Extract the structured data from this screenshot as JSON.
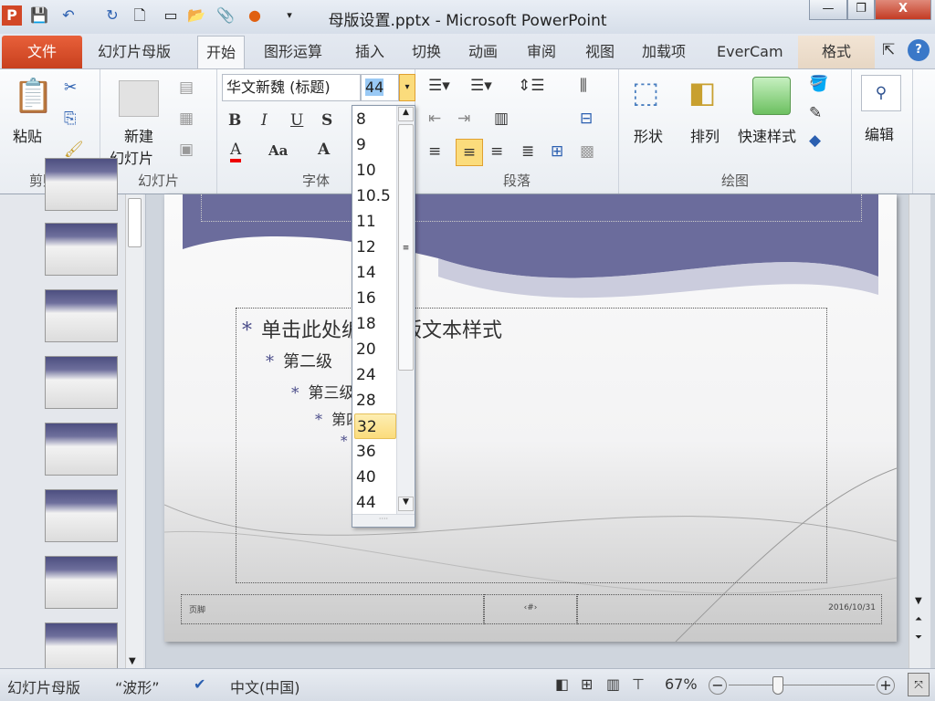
{
  "window": {
    "title": "母版设置.pptx - Microsoft PowerPoint",
    "minimize": "—",
    "restore": "❐",
    "close": "X"
  },
  "tabs": [
    "文件",
    "幻灯片母版",
    "开始",
    "图形运算",
    "插入",
    "切换",
    "动画",
    "审阅",
    "视图",
    "加载项",
    "EverCam",
    "格式"
  ],
  "ribbon": {
    "clipboard": {
      "label": "剪贴板",
      "paste": "粘贴"
    },
    "slides": {
      "label": "幻灯片",
      "new_slide_1": "新建",
      "new_slide_2": "幻灯片"
    },
    "font": {
      "label": "字体",
      "font_name": "华文新魏 (标题)",
      "font_size": "44",
      "bold": "B",
      "italic": "I",
      "underline": "U",
      "shadow": "S",
      "font_color": "A",
      "change_case": "Aa",
      "grow": "A"
    },
    "paragraph": {
      "label": "段落"
    },
    "drawing": {
      "label": "绘图",
      "shapes": "形状",
      "arrange": "排列",
      "quick_styles": "快速样式"
    },
    "editing": {
      "label": "编辑",
      "edit": "编辑"
    }
  },
  "font_size_options": [
    "8",
    "9",
    "10",
    "10.5",
    "11",
    "12",
    "14",
    "16",
    "18",
    "20",
    "24",
    "28",
    "32",
    "36",
    "40",
    "44"
  ],
  "font_size_highlight": "32",
  "slide": {
    "level1": "单击此处编辑母版文本样式",
    "level2": "第二级",
    "level3": "第三级",
    "level4": "第四级",
    "bullet": "*",
    "footer": "页脚",
    "number": "‹#›",
    "date": "2016/10/31"
  },
  "status": {
    "view": "幻灯片母版",
    "theme": "“波形”",
    "language": "中文(中国)",
    "zoom": "67%"
  },
  "colors": {
    "accent": "#c8401e",
    "slide_header": "#5a5b8c",
    "highlight": "#fbdc7c"
  }
}
